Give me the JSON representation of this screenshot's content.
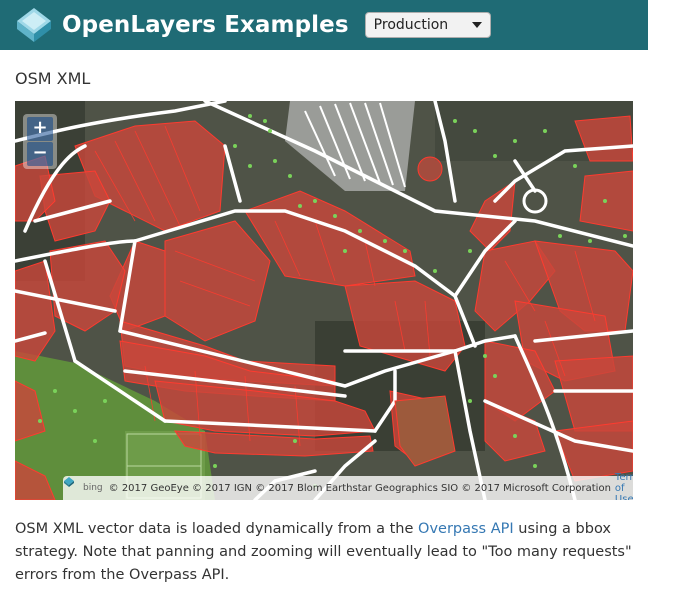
{
  "header": {
    "title": "OpenLayers Examples",
    "version_selected": "Production",
    "colors": {
      "bar": "#1f6b75",
      "text": "#ffffff"
    }
  },
  "page": {
    "title": "OSM XML"
  },
  "map": {
    "zoom_in_label": "+",
    "zoom_out_label": "−",
    "attribution": {
      "bing_label": "bing",
      "text": "© 2017 GeoEye © 2017 IGN © 2017 Blom Earthstar Geographics SIO © 2017 Microsoft Corporation",
      "terms_label": "Terms of Use"
    },
    "colors": {
      "building_fill": "#c8473a",
      "building_stroke": "#ff3b2f",
      "road": "#ffffff",
      "poi": "#7ad25a"
    }
  },
  "description": {
    "part1": "OSM XML vector data is loaded dynamically from a the ",
    "link": "Overpass API",
    "part2": " using a bbox strategy. Note that panning and zooming will eventually lead to \"Too many requests\" errors from the Overpass API."
  }
}
